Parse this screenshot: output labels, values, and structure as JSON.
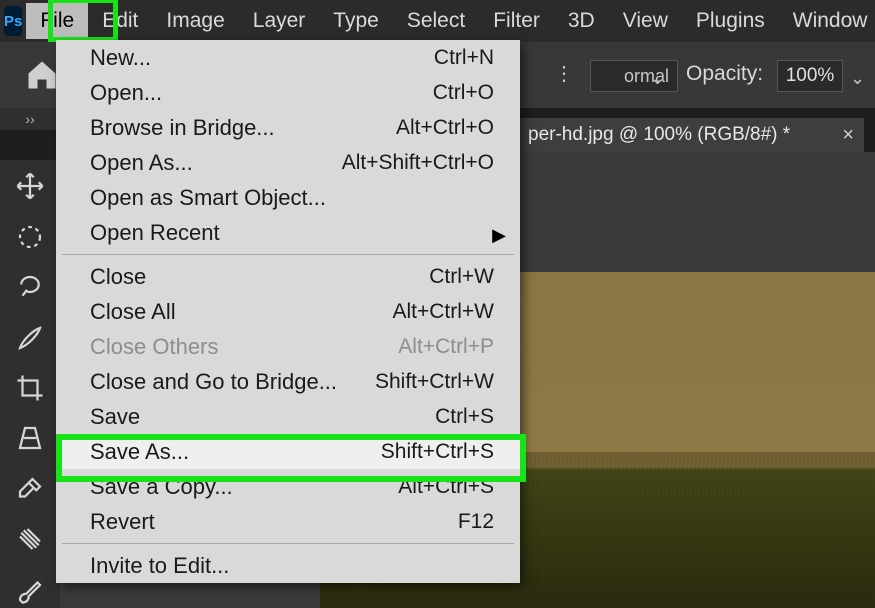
{
  "app_logo": "Ps",
  "menubar": [
    "File",
    "Edit",
    "Image",
    "Layer",
    "Type",
    "Select",
    "Filter",
    "3D",
    "View",
    "Plugins",
    "Window"
  ],
  "active_menu_index": 0,
  "optionsbar": {
    "mode_tail": "ormal",
    "opacity_label": "Opacity:",
    "opacity_value": "100%"
  },
  "chevrons": "››",
  "document_tab": {
    "title": "per-hd.jpg @ 100% (RGB/8#) *"
  },
  "tools": [
    {
      "name": "move-tool",
      "title": "Move Tool"
    },
    {
      "name": "marquee-tool",
      "title": "Elliptical Marquee"
    },
    {
      "name": "lasso-tool",
      "title": "Lasso Tool"
    },
    {
      "name": "brush-soft-tool",
      "title": "Brush"
    },
    {
      "name": "crop-tool",
      "title": "Crop Tool"
    },
    {
      "name": "perspective-tool",
      "title": "Perspective Crop"
    },
    {
      "name": "eyedropper-tool",
      "title": "Eyedropper"
    },
    {
      "name": "healing-tool",
      "title": "Healing Brush"
    },
    {
      "name": "paint-brush-tool",
      "title": "Paint Brush"
    }
  ],
  "file_menu": [
    {
      "label": "New...",
      "shortcut": "Ctrl+N"
    },
    {
      "label": "Open...",
      "shortcut": "Ctrl+O"
    },
    {
      "label": "Browse in Bridge...",
      "shortcut": "Alt+Ctrl+O"
    },
    {
      "label": "Open As...",
      "shortcut": "Alt+Shift+Ctrl+O"
    },
    {
      "label": "Open as Smart Object...",
      "shortcut": ""
    },
    {
      "label": "Open Recent",
      "shortcut": "",
      "submenu": true
    },
    {
      "sep": true
    },
    {
      "label": "Close",
      "shortcut": "Ctrl+W"
    },
    {
      "label": "Close All",
      "shortcut": "Alt+Ctrl+W"
    },
    {
      "label": "Close Others",
      "shortcut": "Alt+Ctrl+P",
      "disabled": true
    },
    {
      "label": "Close and Go to Bridge...",
      "shortcut": "Shift+Ctrl+W"
    },
    {
      "label": "Save",
      "shortcut": "Ctrl+S"
    },
    {
      "label": "Save As...",
      "shortcut": "Shift+Ctrl+S",
      "hover": true,
      "highlight": true
    },
    {
      "label": "Save a Copy...",
      "shortcut": "Alt+Ctrl+S"
    },
    {
      "label": "Revert",
      "shortcut": "F12"
    },
    {
      "sep": true
    },
    {
      "label": "Invite to Edit...",
      "shortcut": ""
    }
  ]
}
